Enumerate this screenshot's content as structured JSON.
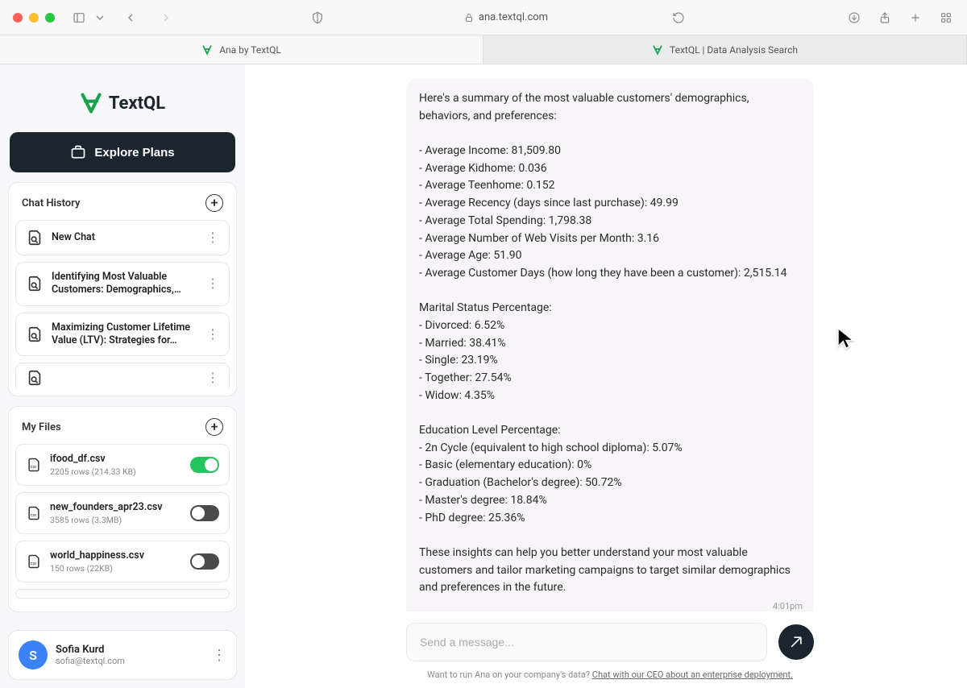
{
  "browser": {
    "url": "ana.textql.com",
    "tabs": [
      {
        "label": "Ana by TextQL",
        "active": true
      },
      {
        "label": "TextQL | Data Analysis Search",
        "active": false
      }
    ]
  },
  "brand": {
    "name": "TextQL"
  },
  "explore_button": "Explore Plans",
  "chat_history": {
    "header": "Chat History",
    "items": [
      {
        "title": "New Chat"
      },
      {
        "title": "Identifying Most Valuable Customers: Demographics,…"
      },
      {
        "title": "Maximizing Customer Lifetime Value (LTV): Strategies for…"
      },
      {
        "title": ""
      }
    ]
  },
  "my_files": {
    "header": "My Files",
    "items": [
      {
        "name": "ifood_df.csv",
        "meta": "2205 rows (214.33 KB)",
        "enabled": true
      },
      {
        "name": "new_founders_apr23.csv",
        "meta": "3585 rows (3.3MB)",
        "enabled": false
      },
      {
        "name": "world_happiness.csv",
        "meta": "150 rows (22KB)",
        "enabled": false
      }
    ]
  },
  "user": {
    "initial": "S",
    "name": "Sofia Kurd",
    "email": "sofia@textql.com"
  },
  "chat": {
    "message": {
      "intro": "Here's a summary of the most valuable customers' demographics, behaviors, and preferences:",
      "bullets_a": [
        "- Average Income: 81,509.80",
        "- Average Kidhome: 0.036",
        "- Average Teenhome: 0.152",
        "- Average Recency (days since last purchase): 49.99",
        "- Average Total Spending: 1,798.38",
        "- Average Number of Web Visits per Month: 3.16",
        "- Average Age: 51.90",
        "- Average Customer Days (how long they have been a customer): 2,515.14"
      ],
      "marital_header": "Marital Status Percentage:",
      "bullets_b": [
        "- Divorced: 6.52%",
        "- Married: 38.41%",
        "- Single: 23.19%",
        "- Together: 27.54%",
        "- Widow: 4.35%"
      ],
      "edu_header": "Education Level Percentage:",
      "bullets_c": [
        "- 2n Cycle (equivalent to high school diploma): 5.07%",
        "- Basic (elementary education): 0%",
        "- Graduation (Bachelor's degree): 50.72%",
        "- Master's degree: 18.84%",
        "- PhD degree: 25.36%"
      ],
      "outro": "These insights can help you better understand your most valuable customers and tailor marketing campaigns to target similar demographics and preferences in the future.",
      "time": "4:01pm"
    },
    "input_placeholder": "Send a message...",
    "footer_prefix": "Want to run Ana on your company's data? ",
    "footer_link": "Chat with our CEO about an enterprise deployment."
  }
}
